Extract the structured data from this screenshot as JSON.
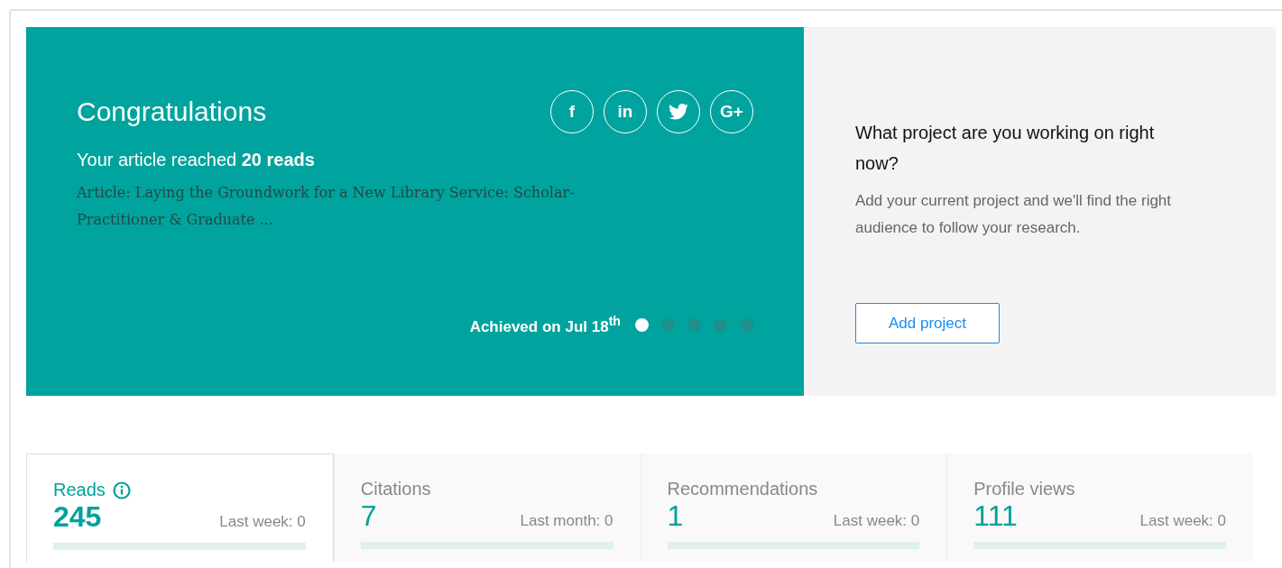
{
  "achievement": {
    "title": "Congratulations",
    "headline": "Your article reached **20 reads**",
    "article": "Article: Laying the Groundwork for a New Library Service: Scholar-Practitioner & Graduate ...",
    "achieved": "Achieved on Jul 18$^{th}$",
    "share": [
      {
        "kind": "text",
        "label": "f"
      },
      {
        "kind": "text",
        "label": "in"
      },
      {
        "kind": "bird"
      },
      {
        "kind": "text",
        "label": "G+"
      }
    ],
    "dots": [
      {
        "selected": true
      },
      {
        "selected": false
      },
      {
        "selected": false
      },
      {
        "selected": false
      },
      {
        "selected": false
      }
    ]
  },
  "project": {
    "question": "What project are you working on right now?",
    "description": "Add your current project and we'll find the right audience to follow your research.",
    "button": "Add project"
  },
  "stats": [
    {
      "label": "Reads",
      "info": true,
      "value": "245",
      "period": "Last week: 0",
      "selected": true
    },
    {
      "label": "Citations",
      "info": false,
      "value": "7",
      "period": "Last month: 0",
      "selected": false
    },
    {
      "label": "Recommendations",
      "info": false,
      "value": "1",
      "period": "Last week: 0",
      "selected": false
    },
    {
      "label": "Profile views",
      "info": false,
      "value": "111",
      "period": "Last week: 0",
      "selected": false
    }
  ]
}
